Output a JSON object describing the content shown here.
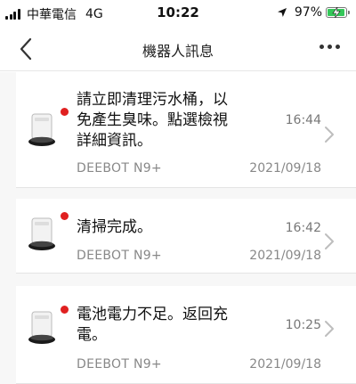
{
  "status_bar": {
    "carrier": "中華電信",
    "network": "4G",
    "time": "10:22",
    "battery_percent": "97%",
    "battery_level": 0.97,
    "battery_color": "#34c759"
  },
  "nav": {
    "back_icon": "chevron-left-icon",
    "title": "機器人訊息",
    "more_icon": "more-horizontal-icon"
  },
  "notifications": [
    {
      "message": "請立即清理污水桶，以免產生臭味。點選檢視詳細資訊。",
      "time": "16:44",
      "device": "DEEBOT N9+",
      "date": "2021/09/18",
      "unread": true
    },
    {
      "message": "清掃完成。",
      "time": "16:42",
      "device": "DEEBOT N9+",
      "date": "2021/09/18",
      "unread": true
    },
    {
      "message": "電池電力不足。返回充電。",
      "time": "10:25",
      "device": "DEEBOT N9+",
      "date": "2021/09/18",
      "unread": true
    }
  ],
  "colors": {
    "unread_dot": "#e02020",
    "accent_text": "#111111"
  }
}
